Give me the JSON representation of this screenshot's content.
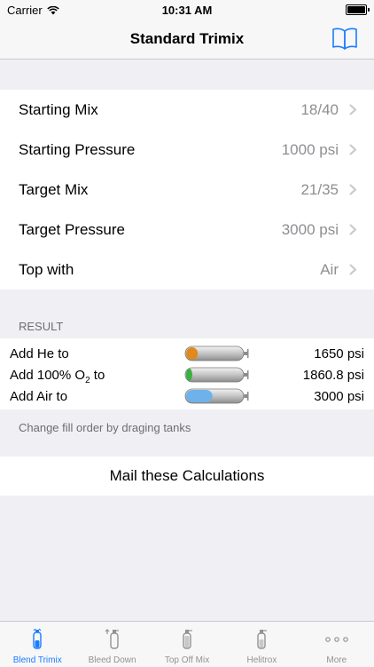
{
  "status_bar": {
    "carrier": "Carrier",
    "time": "10:31 AM"
  },
  "nav": {
    "title": "Standard Trimix",
    "icon": "book-icon"
  },
  "settings": [
    {
      "label": "Starting Mix",
      "value": "18/40"
    },
    {
      "label": "Starting Pressure",
      "value": "1000 psi"
    },
    {
      "label": "Target Mix",
      "value": "21/35"
    },
    {
      "label": "Target Pressure",
      "value": "3000 psi"
    },
    {
      "label": "Top with",
      "value": "Air"
    }
  ],
  "result": {
    "header": "RESULT",
    "rows": [
      {
        "label": "Add He to",
        "amount": "1650 psi",
        "tank_color": "#e08a1e",
        "tank_fill_fraction": 0.2
      },
      {
        "label_prefix": "Add 100% O",
        "label_sub": "2",
        "label_suffix": " to",
        "amount": "1860.8 psi",
        "tank_color": "#3cb043",
        "tank_fill_fraction": 0.05
      },
      {
        "label": "Add Air to",
        "amount": "3000 psi",
        "tank_color": "#6fb2ea",
        "tank_fill_fraction": 0.45
      }
    ],
    "footnote": "Change fill order by draging tanks"
  },
  "mail_button": "Mail these Calculations",
  "tabs": [
    {
      "label": "Blend Trimix",
      "active": true
    },
    {
      "label": "Bleed Down",
      "active": false
    },
    {
      "label": "Top Off Mix",
      "active": false
    },
    {
      "label": "Helitrox",
      "active": false
    },
    {
      "label": "More",
      "active": false
    }
  ],
  "colors": {
    "accent": "#1a7cff",
    "secondary_text": "#8e8e93",
    "background": "#efeff4"
  }
}
